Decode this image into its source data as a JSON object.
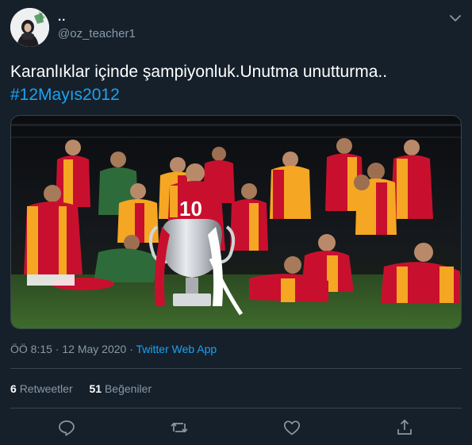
{
  "user": {
    "display_name": "..",
    "handle": "@oz_teacher1",
    "avatar_icon": "avatar-woman-hijab"
  },
  "tweet": {
    "text": "Karanlıklar içinde şampiyonluk.Unutma unutturma..",
    "hashtag": "#12Mayıs2012",
    "media": {
      "kind": "photo",
      "jersey_number": "10"
    }
  },
  "meta": {
    "time": "ÖÖ 8:15",
    "separator1": " · ",
    "date": "12 May 2020",
    "separator2": " · ",
    "source": "Twitter Web App"
  },
  "stats": {
    "retweets_count": "6",
    "retweets_label": "Retweetler",
    "likes_count": "51",
    "likes_label": "Beğeniler"
  },
  "actions": [
    {
      "icon": "reply-icon"
    },
    {
      "icon": "retweet-icon"
    },
    {
      "icon": "like-icon"
    },
    {
      "icon": "share-icon"
    }
  ],
  "colors": {
    "background": "#15202b",
    "text_secondary": "#8899a6",
    "accent": "#1da1f2",
    "border": "#38444d",
    "jersey_red": "#c8102e",
    "jersey_yellow": "#f5a623"
  }
}
